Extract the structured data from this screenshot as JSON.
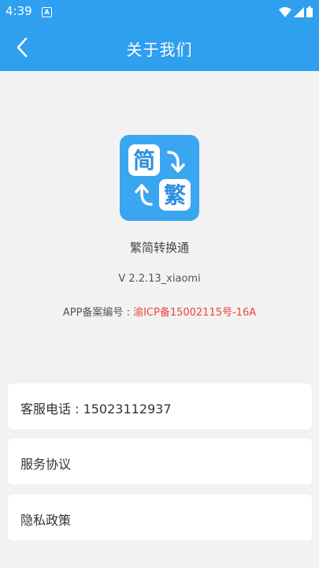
{
  "status_bar": {
    "time": "4:39",
    "notification_icon": "A"
  },
  "header": {
    "title": "关于我们",
    "back_icon": "chevron-left-icon"
  },
  "logo": {
    "top_char": "简",
    "bottom_char": "繁"
  },
  "app": {
    "name": "繁简转换通",
    "version": "V 2.2.13_xiaomi",
    "icp_label": "APP备案编号 : ",
    "icp_number": "渝ICP备15002115号-16A"
  },
  "menu": {
    "customer_service": "客服电话 : 15023112937",
    "service_agreement": "服务协议",
    "privacy_policy": "隐私政策"
  },
  "colors": {
    "primary": "#2f9ff0",
    "icp_red": "#f0433a",
    "background": "#f2f2f2"
  }
}
